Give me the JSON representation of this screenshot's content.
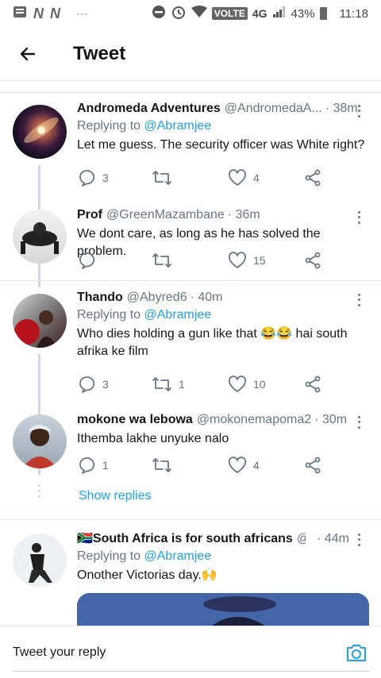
{
  "status_bar": {
    "network_type": "4G",
    "volte_label": "VOLTE",
    "battery": "43%",
    "time": "11:18"
  },
  "header": {
    "title": "Tweet"
  },
  "tweets": [
    {
      "name": "Andromeda Adventures",
      "handle": "@AndromedaA...",
      "time": "· 38m",
      "replying_prefix": "Replying to",
      "replying_to": "@Abramjee",
      "text": "Let me guess. The security officer was White right?",
      "replies": "3",
      "retweets": "",
      "likes": "4"
    },
    {
      "name": "Prof",
      "handle": "@GreenMazambane",
      "time": "· 36m",
      "text": "We dont care, as long as he has solved the problem.",
      "replies": "",
      "retweets": "",
      "likes": "15"
    },
    {
      "name": "Thando",
      "handle": "@Abyred6",
      "time": "· 40m",
      "replying_prefix": "Replying to",
      "replying_to": "@Abramjee",
      "text": "Who dies holding a gun like that 😂😂 hai south afrika ke film",
      "replies": "3",
      "retweets": "1",
      "likes": "10"
    },
    {
      "name": "mokone wa lebowa",
      "handle": "@mokonemapoma2",
      "time": "· 30m",
      "text": "Ithemba lakhe unyuke nalo",
      "replies": "1",
      "retweets": "",
      "likes": "4"
    },
    {
      "name": "🇿🇦South Africa is for south africans",
      "handle": "@...",
      "time": "· 44m",
      "replying_prefix": "Replying to",
      "replying_to": "@Abramjee",
      "text": "Onother Victorias day.🙌"
    }
  ],
  "show_replies": "Show replies",
  "reply_bar": {
    "placeholder": "Tweet your reply"
  },
  "colors": {
    "accent": "#1da1f2",
    "secondary_text": "#657786",
    "divider": "#e1e8ed"
  }
}
